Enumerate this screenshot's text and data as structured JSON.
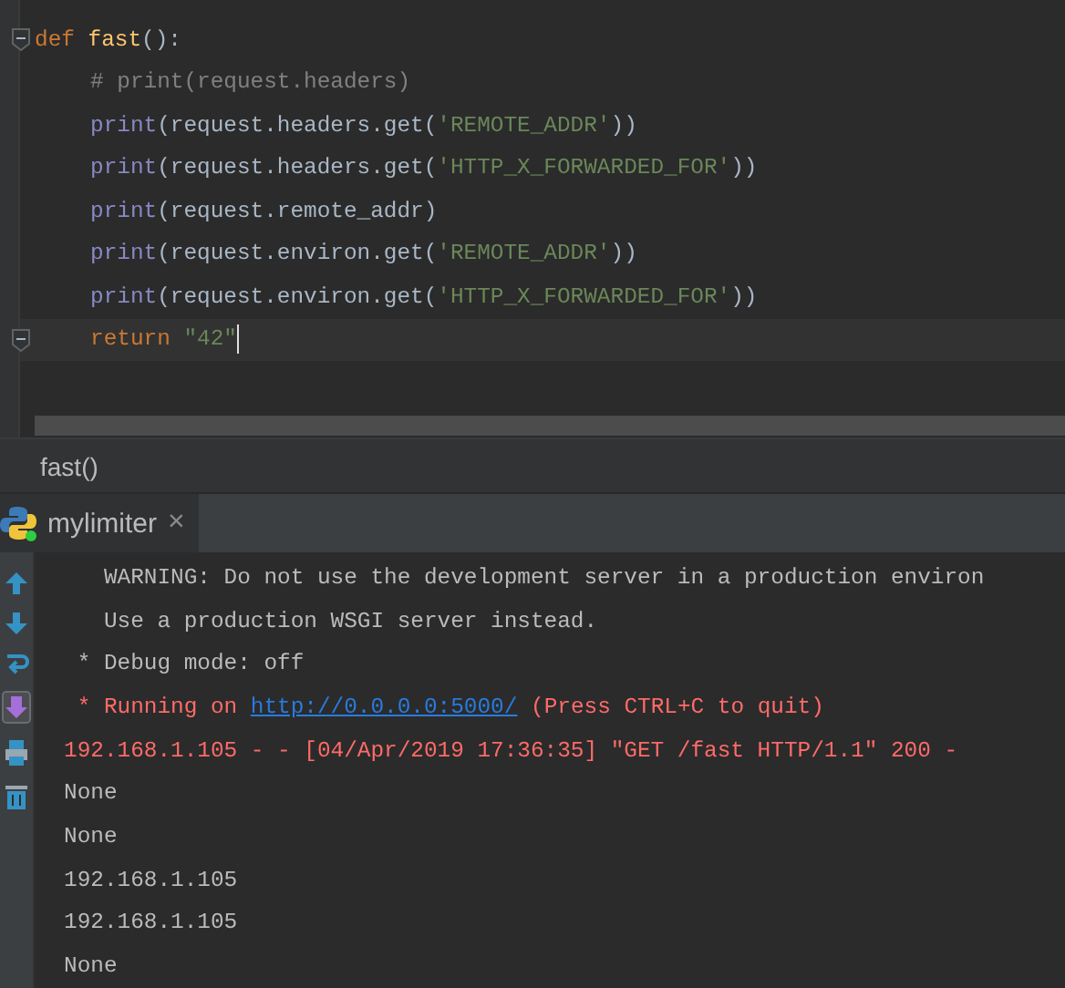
{
  "editor": {
    "lines": [
      {
        "fold": true,
        "tokens": [
          {
            "kind": "keyword",
            "text": "def "
          },
          {
            "kind": "function",
            "text": "fast"
          },
          {
            "kind": "plain",
            "text": "():"
          }
        ],
        "children": [
          {
            "tokens": [
              {
                "kind": "comment",
                "text": "# print(request.headers)"
              }
            ]
          },
          {
            "tokens": [
              {
                "kind": "builtin",
                "text": "print"
              },
              {
                "kind": "plain",
                "text": "(request.headers.get("
              },
              {
                "kind": "string",
                "text": "'REMOTE_ADDR'"
              },
              {
                "kind": "plain",
                "text": "))"
              }
            ]
          },
          {
            "tokens": [
              {
                "kind": "builtin",
                "text": "print"
              },
              {
                "kind": "plain",
                "text": "(request.headers.get("
              },
              {
                "kind": "string",
                "text": "'HTTP_X_FORWARDED_FOR'"
              },
              {
                "kind": "plain",
                "text": "))"
              }
            ]
          },
          {
            "tokens": [
              {
                "kind": "builtin",
                "text": "print"
              },
              {
                "kind": "plain",
                "text": "(request.remote_addr)"
              }
            ]
          },
          {
            "tokens": [
              {
                "kind": "builtin",
                "text": "print"
              },
              {
                "kind": "plain",
                "text": "(request.environ.get("
              },
              {
                "kind": "string",
                "text": "'REMOTE_ADDR'"
              },
              {
                "kind": "plain",
                "text": "))"
              }
            ]
          },
          {
            "tokens": [
              {
                "kind": "builtin",
                "text": "print"
              },
              {
                "kind": "plain",
                "text": "(request.environ.get("
              },
              {
                "kind": "string",
                "text": "'HTTP_X_FORWARDED_FOR'"
              },
              {
                "kind": "plain",
                "text": "))"
              }
            ]
          },
          {
            "fold": true,
            "current": true,
            "tokens": [
              {
                "kind": "keyword",
                "text": "return "
              },
              {
                "kind": "string",
                "text": "\"42\""
              }
            ]
          }
        ]
      }
    ]
  },
  "breadcrumb": "fast()",
  "run_tabs": [
    {
      "label": "mylimiter",
      "selected": true,
      "close": "×"
    }
  ],
  "console": {
    "lines": [
      {
        "segments": [
          {
            "kind": "normal",
            "text": "   WARNING: Do not use the development server in a production environ"
          }
        ]
      },
      {
        "segments": [
          {
            "kind": "normal",
            "text": "   Use a production WSGI server instead."
          }
        ]
      },
      {
        "segments": [
          {
            "kind": "normal",
            "text": " * Debug mode: off"
          }
        ]
      },
      {
        "segments": [
          {
            "kind": "error",
            "text": " * Running on "
          },
          {
            "kind": "link",
            "text": "http://0.0.0.0:5000/"
          },
          {
            "kind": "error",
            "text": " (Press CTRL+C to quit)"
          }
        ]
      },
      {
        "segments": [
          {
            "kind": "error",
            "text": "192.168.1.105 - - [04/Apr/2019 17:36:35] \"GET /fast HTTP/1.1\" 200 -"
          }
        ]
      },
      {
        "segments": [
          {
            "kind": "normal",
            "text": "None"
          }
        ]
      },
      {
        "segments": [
          {
            "kind": "normal",
            "text": "None"
          }
        ]
      },
      {
        "segments": [
          {
            "kind": "normal",
            "text": "192.168.1.105"
          }
        ]
      },
      {
        "segments": [
          {
            "kind": "normal",
            "text": "192.168.1.105"
          }
        ]
      },
      {
        "segments": [
          {
            "kind": "normal",
            "text": "None"
          }
        ]
      }
    ]
  }
}
